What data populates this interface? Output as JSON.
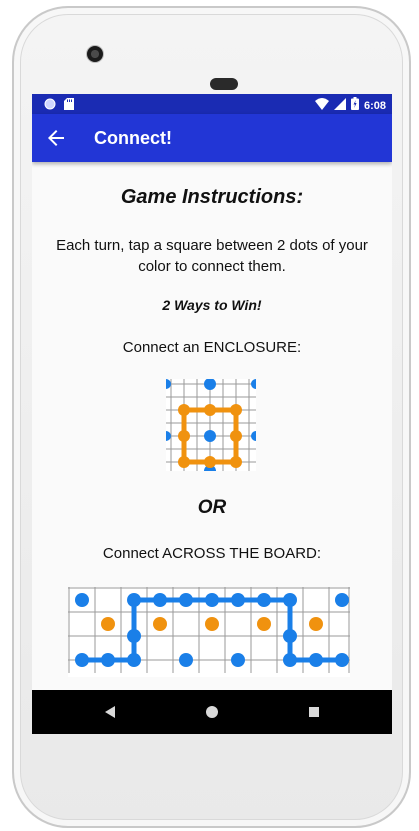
{
  "status_bar": {
    "time": "6:08",
    "icons": [
      "circle-notification-icon",
      "sd-card-icon",
      "wifi-icon",
      "signal-icon",
      "battery-charging-icon"
    ]
  },
  "app_bar": {
    "title": "Connect!",
    "back_icon": "arrow-back-icon"
  },
  "instructions": {
    "heading": "Game Instructions:",
    "body": "Each turn, tap a square between 2 dots of your color to connect them.",
    "ways_to_win": "2 Ways to Win!",
    "enclosure_label": "Connect an ENCLOSURE:",
    "or_text": "OR",
    "across_label": "Connect ACROSS THE BOARD:"
  },
  "colors": {
    "status_bar": "#1a2bb3",
    "app_bar": "#2236d6",
    "player_blue": "#1a7fe8",
    "player_orange": "#f0920f"
  },
  "nav_bar": {
    "icons": [
      "nav-back-icon",
      "nav-home-icon",
      "nav-recents-icon"
    ]
  }
}
